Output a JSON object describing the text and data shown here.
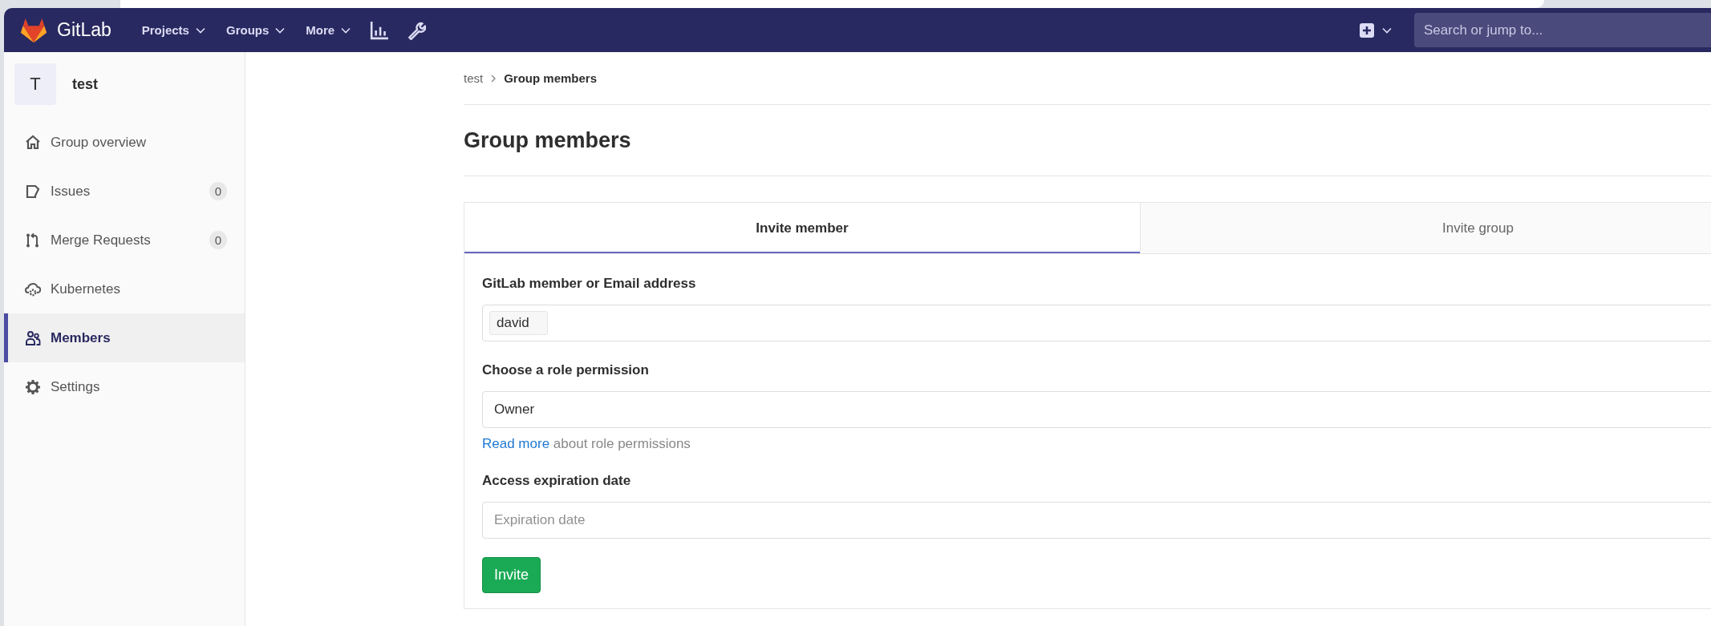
{
  "navbar": {
    "brand": "GitLab",
    "menus": [
      {
        "label": "Projects"
      },
      {
        "label": "Groups"
      },
      {
        "label": "More"
      }
    ],
    "search": {
      "placeholder": "Search or jump to..."
    }
  },
  "sidebar": {
    "group": {
      "avatar_letter": "T",
      "name": "test"
    },
    "items": [
      {
        "label": "Group overview",
        "kind": "home",
        "selected": false
      },
      {
        "label": "Issues",
        "kind": "issues",
        "count": "0",
        "selected": false
      },
      {
        "label": "Merge Requests",
        "kind": "merge",
        "count": "0",
        "selected": false
      },
      {
        "label": "Kubernetes",
        "kind": "cloud",
        "selected": false
      },
      {
        "label": "Members",
        "kind": "people",
        "selected": true
      },
      {
        "label": "Settings",
        "kind": "gear",
        "selected": false
      }
    ]
  },
  "breadcrumb": [
    {
      "label": "test"
    },
    {
      "label": "Group members"
    }
  ],
  "page_title": "Group members",
  "tabs": [
    {
      "label": "Invite member",
      "selected": true
    },
    {
      "label": "Invite group",
      "selected": false
    }
  ],
  "form": {
    "member_field": {
      "label": "GitLab member or Email address",
      "tokens": [
        "david"
      ]
    },
    "role_field": {
      "label": "Choose a role permission",
      "value": "Owner",
      "help_link": "Read more",
      "help_text": " about role permissions"
    },
    "expiry_field": {
      "label": "Access expiration date",
      "placeholder": "Expiration date"
    },
    "submit": "Invite"
  }
}
